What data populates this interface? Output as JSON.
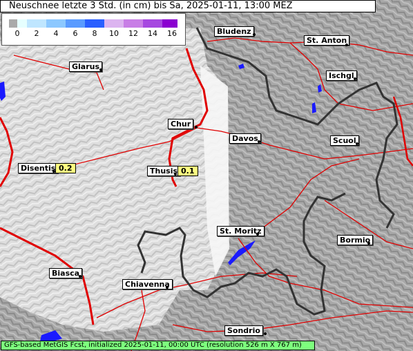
{
  "title": "Neuschnee letzte 3 Std. (in cm) bis Sa, 2025-01-11, 13:00 MEZ",
  "legend": {
    "ticks": [
      "0",
      "2",
      "4",
      "6",
      "8",
      "10",
      "12",
      "14",
      "16"
    ],
    "colors": [
      "#aaaaaa",
      "#e6ffff",
      "#bfe6ff",
      "#8cc8ff",
      "#5a9bff",
      "#2a5fff",
      "#dcb4f0",
      "#c87ee6",
      "#a648e0",
      "#8a00d0"
    ]
  },
  "cities": [
    {
      "name": "Bludenz",
      "id": "bludenz"
    },
    {
      "name": "St. Anton",
      "id": "st-anton"
    },
    {
      "name": "Glarus",
      "id": "glarus"
    },
    {
      "name": "Ischgl",
      "id": "ischgl"
    },
    {
      "name": "Chur",
      "id": "chur"
    },
    {
      "name": "Davos",
      "id": "davos"
    },
    {
      "name": "Scuol",
      "id": "scuol"
    },
    {
      "name": "Disentis",
      "id": "disentis"
    },
    {
      "name": "Thusis",
      "id": "thusis"
    },
    {
      "name": "St. Moritz",
      "id": "st-moritz"
    },
    {
      "name": "Bormio",
      "id": "bormio"
    },
    {
      "name": "Biasca",
      "id": "biasca"
    },
    {
      "name": "Chiavenna",
      "id": "chiavenna"
    },
    {
      "name": "Sondrio",
      "id": "sondrio"
    }
  ],
  "values": [
    {
      "city": "Disentis",
      "value": "0.2"
    },
    {
      "city": "Thusis",
      "value": "0.1"
    }
  ],
  "footer": "GFS-based MetGIS Fcst, initialized 2025-01-11, 00:00 UTC  (resolution 526 m X 767 m)",
  "colors": {
    "roads": "#e00000",
    "border": "#333333",
    "lakes": "#1a1aff",
    "snow_light": "#f4f4f4"
  }
}
